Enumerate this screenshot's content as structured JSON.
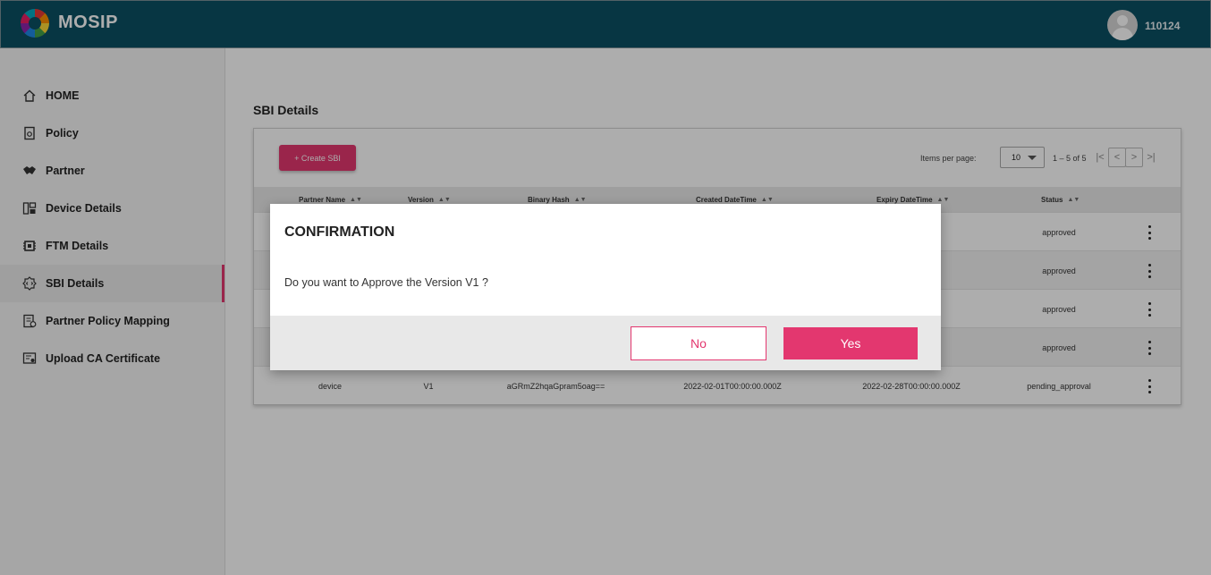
{
  "header": {
    "brand": "MOSIP",
    "username": "110124"
  },
  "sidebar": {
    "items": [
      {
        "label": "HOME",
        "icon": "home-icon"
      },
      {
        "label": "Policy",
        "icon": "policy-document-icon"
      },
      {
        "label": "Partner",
        "icon": "handshake-icon"
      },
      {
        "label": "Device Details",
        "icon": "device-icon"
      },
      {
        "label": "FTM Details",
        "icon": "chip-icon"
      },
      {
        "label": "SBI Details",
        "icon": "code-gear-icon",
        "active": true
      },
      {
        "label": "Partner Policy Mapping",
        "icon": "mapping-document-icon"
      },
      {
        "label": "Upload CA Certificate",
        "icon": "certificate-icon"
      }
    ]
  },
  "main": {
    "title": "SBI Details",
    "create_button": "+ Create SBI",
    "paginator": {
      "items_per_page_label": "Items per page:",
      "items_per_page": "10",
      "range": "1 – 5 of 5"
    },
    "columns": [
      "Partner Name",
      "Version",
      "Binary Hash",
      "Created DateTime",
      "Expiry DateTime",
      "Status"
    ],
    "rows": [
      {
        "partner": "",
        "version": "",
        "hash": "",
        "created": "",
        "expiry": ".000Z",
        "status": "approved"
      },
      {
        "partner": "",
        "version": "",
        "hash": "",
        "created": "",
        "expiry": ".375Z",
        "status": "approved"
      },
      {
        "partner": "",
        "version": "",
        "hash": "",
        "created": "",
        "expiry": ".000Z",
        "status": "approved"
      },
      {
        "partner": "",
        "version": "",
        "hash": "",
        "created": "",
        "expiry": ".000Z",
        "status": "approved"
      },
      {
        "partner": "device",
        "version": "V1",
        "hash": "aGRmZ2hqaGpram5oag==",
        "created": "2022-02-01T00:00:00.000Z",
        "expiry": "2022-02-28T00:00:00.000Z",
        "status": "pending_approval"
      }
    ]
  },
  "dialog": {
    "title": "CONFIRMATION",
    "message": "Do you want to Approve the Version V1 ?",
    "no_label": "No",
    "yes_label": "Yes"
  },
  "colors": {
    "header": "#0b5064",
    "accent": "#e3376f"
  }
}
